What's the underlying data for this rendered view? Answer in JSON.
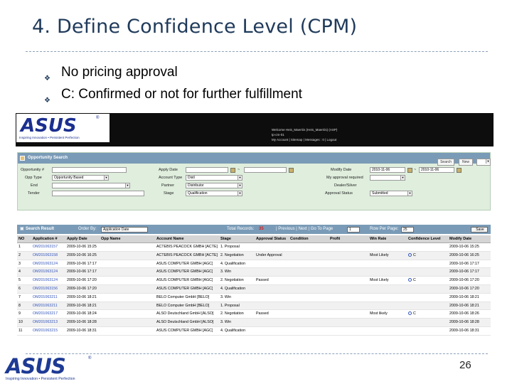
{
  "slide": {
    "title": "4. Define Confidence Level (CPM)",
    "bullets": [
      "No pricing approval",
      "C: Confirmed or not for further fulfillment"
    ],
    "page_number": "26",
    "bottom_logo": {
      "word": "ASUS",
      "tagline": "Inspiring Innovation • Persistent Perfection"
    }
  },
  "app": {
    "logo": {
      "word": "ASUS",
      "tagline": "Inspiring Innovation • Persistent Perfection"
    },
    "user_bar": {
      "line1": "Welcome Heis_Maerriis (Heis_Maerriis) (ASP)",
      "line2": "tp-cm-01",
      "line3": "My Account | Sitemap | Messages : 0 | Logout"
    },
    "search": {
      "title": "Opportunity Search",
      "buttons": {
        "search": "Search",
        "new": "New"
      },
      "fields": {
        "opportunity": "Opportunity #",
        "opp_type": "Opp Type",
        "opp_type_value": "Opportunity Based",
        "end": "End",
        "tender": "Tender",
        "apply_date": "Apply Date",
        "account_type": "Account Type",
        "account_type_value": "Distl",
        "partner": "Partner",
        "partner_value": "Distributor",
        "stage": "Stage",
        "stage_value": "Qualification",
        "modify_date": "Modify Date",
        "modify_from": "2010-11-06",
        "modify_to": "2010-11-06",
        "my_approval": "My approval required",
        "dealer": "Dealer/Silver",
        "approval_status": "Approval Status",
        "approval_status_value": "Submitted"
      }
    },
    "results": {
      "title": "Search Result",
      "order_by_label": "Order By:",
      "order_by_value": "Application Date",
      "total_label": "Total Records:",
      "total_value": "35",
      "pager": "| Previous | Next | Go To Page",
      "page_value": "1",
      "rows_per_page_label": "Row Per Page:",
      "rows_per_page_value": "25",
      "save": "Save",
      "columns": [
        "NO",
        "Application #",
        "Apply Date",
        "Opp Name",
        "Account Name",
        "Stage",
        "Approval Status",
        "Condition",
        "Profit",
        "Win Rate",
        "Confidence Level",
        "Modify Date"
      ],
      "rows": [
        [
          "1",
          "OM201063157",
          "2009-10-06 15:25",
          "",
          "ACTEBIS PEACOCK GMBH [ACTE]",
          "1. Proposal",
          "",
          "",
          "",
          "",
          "",
          "2009-10-06 15:25"
        ],
        [
          "2",
          "OM201063158",
          "2009-10-06 16:25",
          "",
          "ACTEBIS PEACOCK GMBH [ACTE]",
          "2. Negotiation",
          "Under Approval",
          "",
          "",
          "Most Likely",
          "C",
          "2009-10-06 16:25"
        ],
        [
          "3",
          "OM201063124",
          "2009-10-06 17:17",
          "",
          "ASUS COMPUTER GMBH [AGC]",
          "4. Qualification",
          "",
          "",
          "",
          "",
          "",
          "2009-10-06 17:17"
        ],
        [
          "4",
          "OM201063124",
          "2009-10-06 17:17",
          "",
          "ASUS COMPUTER GMBH [AGC]",
          "3. Win",
          "",
          "",
          "",
          "",
          "",
          "2009-10-06 17:17"
        ],
        [
          "5",
          "OM201063124",
          "2009-10-06 17:20",
          "",
          "ASUS COMPUTER GMBH [AGC]",
          "2. Negotiation",
          "Passed",
          "",
          "",
          "Most Likely",
          "C",
          "2009-10-06 17:20"
        ],
        [
          "6",
          "OM201063156",
          "2009-10-06 17:20",
          "",
          "ASUS COMPUTER GMBH [AGC]",
          "4. Qualification",
          "",
          "",
          "",
          "",
          "",
          "2009-10-06 17:20"
        ],
        [
          "7",
          "OM201063211",
          "2009-10-06 18:21",
          "",
          "BELO Computer GmbH [BELO]",
          "3. Win",
          "",
          "",
          "",
          "",
          "",
          "2009-10-06 18:21"
        ],
        [
          "8",
          "OM201063211",
          "2009-10-06 18:21",
          "",
          "BELO Computer GmbH [BELO]",
          "1. Proposal",
          "",
          "",
          "",
          "",
          "",
          "2009-10-06 18:21"
        ],
        [
          "9",
          "OM201063217",
          "2009-10-06 18:24",
          "",
          "ALSO Deutschland GmbH [ALSO]",
          "2. Negotiation",
          "Passed",
          "",
          "",
          "Most likely",
          "C",
          "2009-10-06 18:26"
        ],
        [
          "10",
          "OM201063213",
          "2009-10-06 18:28",
          "",
          "ALSO Deutschland GmbH [ALSO]",
          "3. Win",
          "",
          "",
          "",
          "",
          "",
          "2009-10-06 18:28"
        ],
        [
          "11",
          "OM201063215",
          "2009-10-06 18:31",
          "",
          "ASUS COMPUTER GMBH [AGC]",
          "4. Qualification",
          "",
          "",
          "",
          "",
          "",
          "2009-10-06 18:31"
        ]
      ]
    }
  },
  "colors": {
    "title": "#1f3a5a",
    "panel_bg": "#dfeedd",
    "header_blue": "#7a9bb7",
    "link": "#3355bb",
    "logo": "#1b2f8f"
  }
}
